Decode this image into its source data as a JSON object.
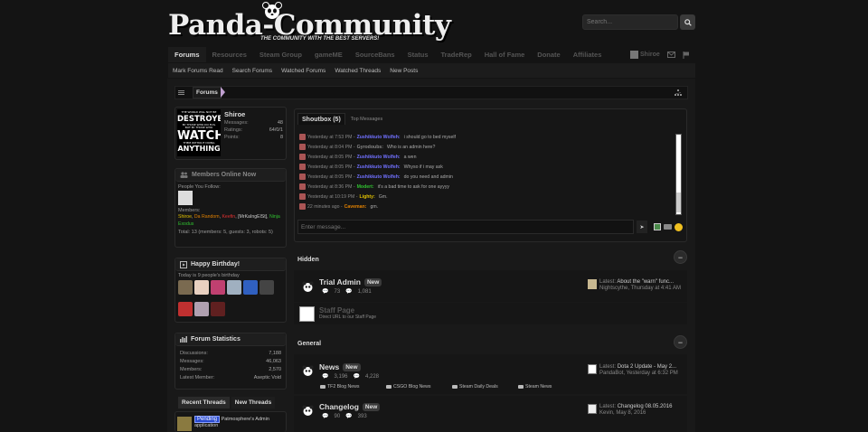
{
  "site": {
    "logo_text": "Panda-Community",
    "tagline": "THE COMMUNITY WITH THE BEST SERVERS!",
    "search_placeholder": "Search..."
  },
  "nav": {
    "tabs": [
      "Forums",
      "Resources",
      "Steam Group",
      "gameME",
      "SourceBans",
      "Status",
      "TradeRep",
      "Hall of Fame",
      "Donate",
      "Affiliates"
    ],
    "user": "Shiroe",
    "subnav": [
      "Mark Forums Read",
      "Search Forums",
      "Watched Forums",
      "Watched Threads",
      "New Posts"
    ]
  },
  "breadcrumb": {
    "current": "Forums"
  },
  "visitor": {
    "avatar_lines": [
      "THE WORLD WILL NOT BE",
      "DESTROYED",
      "BY THOSE WHO DO EVIL",
      "BUT BY THOSE WHO",
      "WATCH",
      "THEM WITHOUT DOING",
      "ANYTHING"
    ],
    "name": "Shiroe",
    "messages_label": "Messages:",
    "messages": "48",
    "ratings_label": "Ratings:",
    "ratings": "64/0/1",
    "points_label": "Points:",
    "points": "8"
  },
  "members_online": {
    "title": "Members Online Now",
    "follow_label": "People You Follow:",
    "members_label": "Members:",
    "members": [
      {
        "name": "Shiroe",
        "color": "#e0c000"
      },
      {
        "name": "Da Random",
        "color": "#e08000"
      },
      {
        "name": "Keefin",
        "color": "#e03030"
      },
      {
        "name": "[MrKaIngElSt]",
        "color": "#cccccc"
      },
      {
        "name": "Ninja Exodus",
        "color": "#30c030"
      }
    ],
    "totals": "Total: 13 (members: 5, guests: 3, robots: 5)"
  },
  "birthday": {
    "title": "Happy Birthday!",
    "text": "Today is 9 people's birthday"
  },
  "forum_stats": {
    "title": "Forum Statistics",
    "rows": [
      {
        "label": "Discussions:",
        "value": "7,188"
      },
      {
        "label": "Messages:",
        "value": "46,063"
      },
      {
        "label": "Members:",
        "value": "2,570"
      },
      {
        "label": "Latest Member:",
        "value": "Aseptic Void"
      }
    ]
  },
  "recent": {
    "tabs": [
      "Recent Threads",
      "New Threads"
    ],
    "badge": "Pending",
    "title": "Patmosphere's Admin",
    "title2": "application"
  },
  "shoutbox": {
    "tab": "Shoutbox (5)",
    "tab2": "Top Messages",
    "input_placeholder": "Enter message...",
    "send_label": "➤",
    "messages": [
      {
        "time": "Yesterday at 7:53 PM -",
        "user": "Zushikkuto Wolfeh:",
        "color": "#7070ff",
        "text": "i should go to bed myself"
      },
      {
        "time": "Yesterday at 8:04 PM -",
        "user": "Gyrodoubs:",
        "color": "#888888",
        "text": "Who is an admin here?"
      },
      {
        "time": "Yesterday at 8:05 PM -",
        "user": "Zushikkuto Wolfeh:",
        "color": "#7070ff",
        "text": "a wen"
      },
      {
        "time": "Yesterday at 8:05 PM -",
        "user": "Zushikkuto Wolfeh:",
        "color": "#7070ff",
        "text": "Whyso if i may ask"
      },
      {
        "time": "Yesterday at 8:05 PM -",
        "user": "Zushikkuto Wolfeh:",
        "color": "#7070ff",
        "text": "do you need and admin"
      },
      {
        "time": "Yesterday at 8:36 PM -",
        "user": "Modert:",
        "color": "#30c030",
        "text": "it's a bad time to ask for one ayyyy"
      },
      {
        "time": "Yesterday at 10:19 PM -",
        "user": "Lighty:",
        "color": "#e0c000",
        "text": "Gm."
      },
      {
        "time": "22 minutes ago -",
        "user": "Caveman:",
        "color": "#e08000",
        "text": "gm."
      }
    ]
  },
  "categories": [
    {
      "title": "Hidden",
      "nodes": [
        {
          "title": "Trial Admin",
          "badge": "New",
          "threads": "73",
          "posts": "1,081",
          "latest_label": "Latest:",
          "latest_title": "About the \"warn\" func...",
          "latest_user": "Nightscythe,",
          "latest_time": "Thursday at 4:41 AM"
        },
        {
          "title": "Staff Page",
          "desc": "Direct URL to our Staff Page"
        }
      ]
    },
    {
      "title": "General",
      "nodes": [
        {
          "title": "News",
          "badge": "New",
          "threads": "3,196",
          "posts": "4,228",
          "latest_label": "Latest:",
          "latest_title": "Dota 2 Update - May 2...",
          "latest_user": "PandaBot,",
          "latest_time": "Yesterday at 6:32 PM",
          "subforums": [
            "TF2 Blog News",
            "CSGO Blog News",
            "Steam Daily Deals",
            "Steam News"
          ]
        },
        {
          "title": "Changelog",
          "badge": "New",
          "threads": "90",
          "posts": "393",
          "latest_label": "Latest:",
          "latest_title": "Changelog 08.05.2016",
          "latest_user": "Kevin,",
          "latest_time": "May 8, 2016"
        }
      ]
    }
  ],
  "colors": {
    "accent": "#c0a0d0",
    "bg": "#141414"
  }
}
